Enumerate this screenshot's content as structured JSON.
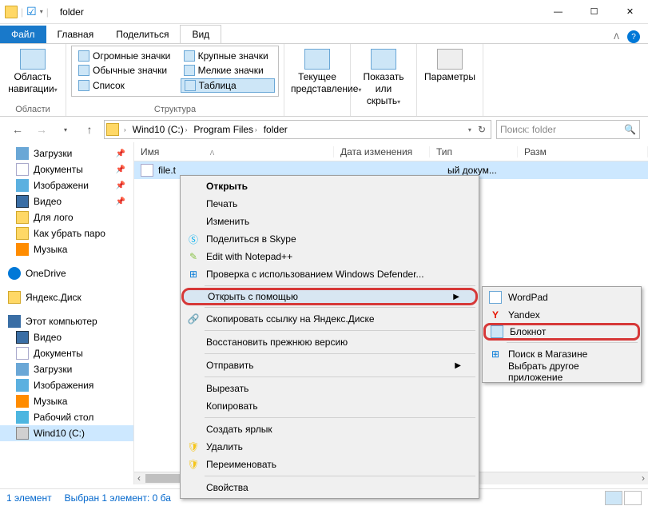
{
  "window": {
    "title": "folder"
  },
  "tabs": {
    "file": "Файл",
    "home": "Главная",
    "share": "Поделиться",
    "view": "Вид"
  },
  "ribbon": {
    "panes": {
      "btn": "Область навигации",
      "group": "Области"
    },
    "layout": {
      "huge": "Огромные значки",
      "large": "Крупные значки",
      "normal": "Обычные значки",
      "small": "Мелкие значки",
      "list": "Список",
      "table": "Таблица",
      "group": "Структура"
    },
    "current": {
      "btn": "Текущее представление"
    },
    "show": {
      "btn": "Показать или скрыть"
    },
    "options": {
      "btn": "Параметры"
    }
  },
  "address": {
    "drive": "Wind10 (C:)",
    "p1": "Program Files",
    "p2": "folder"
  },
  "search": {
    "placeholder": "Поиск: folder"
  },
  "columns": {
    "name": "Имя",
    "date": "Дата изменения",
    "type": "Тип",
    "size": "Разм"
  },
  "file": {
    "name": "file.t",
    "type_trunc": "ый докум..."
  },
  "sidebar": {
    "downloads": "Загрузки",
    "documents": "Документы",
    "pictures": "Изображени",
    "video": "Видео",
    "forlogo": "Для лого",
    "howto": "Как убрать паро",
    "music": "Музыка",
    "onedrive": "OneDrive",
    "yadisk": "Яндекс.Диск",
    "thispc": "Этот компьютер",
    "video2": "Видео",
    "documents2": "Документы",
    "downloads2": "Загрузки",
    "pictures2": "Изображения",
    "music2": "Музыка",
    "desktop": "Рабочий стол",
    "drive": "Wind10 (C:)"
  },
  "status": {
    "count": "1 элемент",
    "selected": "Выбран 1 элемент: 0 ба"
  },
  "ctx": {
    "open": "Открыть",
    "print": "Печать",
    "edit": "Изменить",
    "skype": "Поделиться в Skype",
    "npp": "Edit with Notepad++",
    "defender": "Проверка с использованием Windows Defender...",
    "openwith": "Открыть с помощью",
    "yalink": "Скопировать ссылку на Яндекс.Диске",
    "restore": "Восстановить прежнюю версию",
    "sendto": "Отправить",
    "cut": "Вырезать",
    "copy": "Копировать",
    "shortcut": "Создать ярлык",
    "delete": "Удалить",
    "rename": "Переименовать",
    "props": "Свойства"
  },
  "sub": {
    "wordpad": "WordPad",
    "yandex": "Yandex",
    "notepad": "Блокнот",
    "store": "Поиск в Магазине",
    "other": "Выбрать другое приложение"
  }
}
